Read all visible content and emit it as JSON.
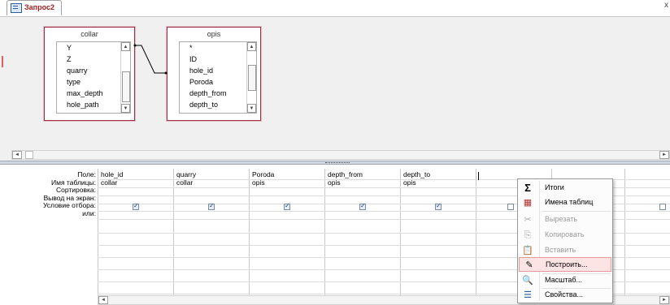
{
  "tab": {
    "title": "Запрос2",
    "close": "x"
  },
  "tables": [
    {
      "name": "collar",
      "fields": [
        "Y",
        "Z",
        "quarry",
        "type",
        "max_depth",
        "hole_path"
      ]
    },
    {
      "name": "opis",
      "fields": [
        "*",
        "ID",
        "hole_id",
        "Poroda",
        "depth_from",
        "depth_to"
      ]
    }
  ],
  "scroll": {
    "left": "◄",
    "right": "►",
    "up": "▲",
    "down": "▼"
  },
  "grid": {
    "row_labels": [
      "Поле:",
      "Имя таблицы:",
      "Сортировка:",
      "Вывод на экран:",
      "Условие отбора:",
      "или:"
    ],
    "columns": [
      {
        "field": "hole_id",
        "table": "collar",
        "show": true
      },
      {
        "field": "quarry",
        "table": "collar",
        "show": true
      },
      {
        "field": "Poroda",
        "table": "opis",
        "show": true
      },
      {
        "field": "depth_from",
        "table": "opis",
        "show": true
      },
      {
        "field": "depth_to",
        "table": "opis",
        "show": true
      },
      {
        "field": "",
        "table": "",
        "show": false
      },
      {
        "field": "",
        "table": "",
        "show": false
      },
      {
        "field": "",
        "table": "",
        "show": false
      }
    ]
  },
  "context_menu": {
    "items": [
      {
        "icon": "sigma-icon",
        "glyph": "Σ",
        "label": "Итоги",
        "enabled": true
      },
      {
        "icon": "table-names-icon",
        "glyph": "▦",
        "label": "Имена таблиц",
        "enabled": true
      },
      {
        "icon": "cut-icon",
        "glyph": "✂",
        "label": "Вырезать",
        "enabled": false
      },
      {
        "icon": "copy-icon",
        "glyph": "⎘",
        "label": "Копировать",
        "enabled": false
      },
      {
        "icon": "paste-icon",
        "glyph": "📋",
        "label": "Вставить",
        "enabled": false
      },
      {
        "icon": "build-icon",
        "glyph": "✎",
        "label": "Построить...",
        "enabled": true,
        "highlighted": true
      },
      {
        "icon": "zoom-icon",
        "glyph": "🔍",
        "label": "Масштаб...",
        "enabled": true
      },
      {
        "icon": "properties-icon",
        "glyph": "☰",
        "label": "Свойства...",
        "enabled": true
      }
    ]
  }
}
